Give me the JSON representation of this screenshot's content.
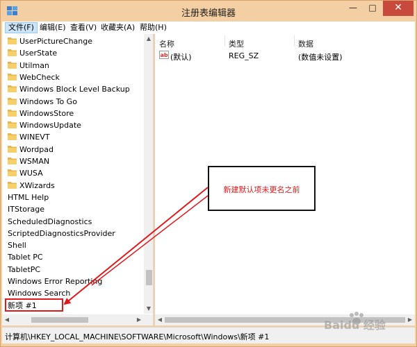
{
  "window": {
    "title": "注册表编辑器",
    "minimize_glyph": "—",
    "maximize_glyph": "□",
    "close_glyph": "✕"
  },
  "menu": [
    {
      "label": "文件(F)",
      "active": true
    },
    {
      "label": "编辑(E)",
      "active": false
    },
    {
      "label": "查看(V)",
      "active": false
    },
    {
      "label": "收藏夹(A)",
      "active": false
    },
    {
      "label": "帮助(H)",
      "active": false
    }
  ],
  "tree": {
    "folders": [
      "UserPictureChange",
      "UserState",
      "Utilman",
      "WebCheck",
      "Windows Block Level Backup",
      "Windows To Go",
      "WindowsStore",
      "WindowsUpdate",
      "WINEVT",
      "Wordpad",
      "WSMAN",
      "WUSA",
      "XWizards"
    ],
    "items": [
      "HTML Help",
      "ITStorage",
      "ScheduledDiagnostics",
      "ScriptedDiagnosticsProvider",
      "Shell",
      "Tablet PC",
      "TabletPC",
      "Windows Error Reporting",
      "Windows Search",
      "新项 #1"
    ],
    "selected": "新项 #1"
  },
  "list": {
    "columns": [
      "名称",
      "类型",
      "数据"
    ],
    "rows": [
      {
        "name": "(默认)",
        "type": "REG_SZ",
        "data": "(数值未设置)",
        "icon": "string-value-icon"
      }
    ]
  },
  "status": {
    "path": "计算机\\HKEY_LOCAL_MACHINE\\SOFTWARE\\Microsoft\\Windows\\新项 #1"
  },
  "annotation": {
    "callout_text": "新建默认项未更名之前",
    "color": "#e0191b"
  },
  "watermark": {
    "text": "Baidu 经验"
  },
  "colors": {
    "titlebar": "#f3cfa3",
    "close_button": "#c74a3c",
    "folder": "#e8b64a",
    "menu_highlight": "#cce4f7"
  }
}
